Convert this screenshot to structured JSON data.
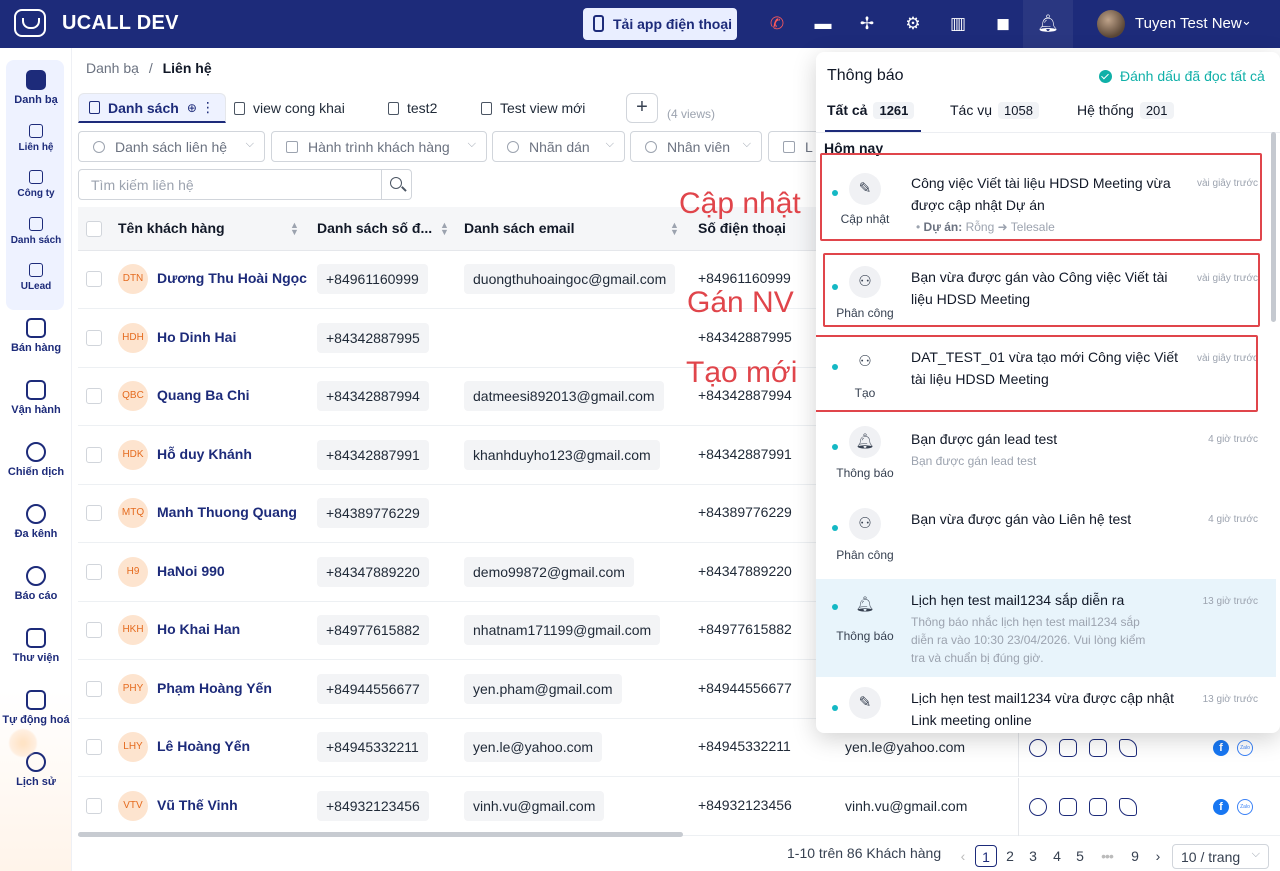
{
  "topbar": {
    "brand": "UCALL DEV",
    "app_button": "Tải app điện thoại",
    "user_name": "Tuyen Test New",
    "icons": [
      "phone-icon",
      "chat-icon",
      "apps-icon",
      "gear-icon",
      "book-icon",
      "briefcase-icon",
      "bell-icon"
    ]
  },
  "sidebar": {
    "items": [
      {
        "label": "Danh bạ",
        "icon": "contact-card-icon"
      },
      {
        "label": "Liên hệ",
        "icon": "users-icon"
      },
      {
        "label": "Công ty",
        "icon": "building-icon"
      },
      {
        "label": "Danh sách",
        "icon": "list-icon"
      },
      {
        "label": "ULead",
        "icon": "lead-icon"
      },
      {
        "label": "Bán hàng",
        "icon": "store-icon"
      },
      {
        "label": "Vận hành",
        "icon": "briefcase-icon"
      },
      {
        "label": "Chiến dịch",
        "icon": "target-icon"
      },
      {
        "label": "Đa kênh",
        "icon": "chat-bubble-icon"
      },
      {
        "label": "Báo cáo",
        "icon": "report-icon"
      },
      {
        "label": "Thư viện",
        "icon": "library-icon"
      },
      {
        "label": "Tự động hoá",
        "icon": "flow-icon"
      },
      {
        "label": "Lịch sử",
        "icon": "clock-icon"
      }
    ]
  },
  "breadcrumb": {
    "parent": "Danh bạ",
    "separator": "/",
    "current": "Liên hệ"
  },
  "views": {
    "tabs": [
      {
        "label": "Danh sách"
      },
      {
        "label": "view cong khai"
      },
      {
        "label": "test2"
      },
      {
        "label": "Test view mới"
      }
    ],
    "add": "+",
    "count": "(4 views)"
  },
  "filters": [
    "Danh sách liên hệ",
    "Hành trình khách hàng",
    "Nhãn dán",
    "Nhân viên",
    "L"
  ],
  "search": {
    "placeholder": "Tìm kiếm liên hệ"
  },
  "table": {
    "columns": [
      "Tên khách hàng",
      "Danh sách số đ...",
      "Danh sách email",
      "Số điện thoại"
    ],
    "rows": [
      {
        "initials": "DTN",
        "name": "Dương Thu Hoài Ngọc",
        "phone_list": "+84961160999",
        "email_list": "duongthuhoaingoc@gmail.com",
        "phone": "+84961160999",
        "email": ""
      },
      {
        "initials": "HDH",
        "name": "Ho Dinh Hai",
        "phone_list": "+84342887995",
        "email_list": "",
        "phone": "+84342887995",
        "email": ""
      },
      {
        "initials": "QBC",
        "name": "Quang Ba Chi",
        "phone_list": "+84342887994",
        "email_list": "datmeesi892013@gmail.com",
        "phone": "+84342887994",
        "email": ""
      },
      {
        "initials": "HDK",
        "name": "Hỗ duy Khánh",
        "phone_list": "+84342887991",
        "email_list": "khanhduyho123@gmail.com",
        "phone": "+84342887991",
        "email": ""
      },
      {
        "initials": "MTQ",
        "name": "Manh Thuong Quang",
        "phone_list": "+84389776229",
        "email_list": "",
        "phone": "+84389776229",
        "email": ""
      },
      {
        "initials": "H9",
        "name": "HaNoi 990",
        "phone_list": "+84347889220",
        "email_list": "demo99872@gmail.com",
        "phone": "+84347889220",
        "email": ""
      },
      {
        "initials": "HKH",
        "name": "Ho Khai Han",
        "phone_list": "+84977615882",
        "email_list": "nhatnam171199@gmail.com",
        "phone": "+84977615882",
        "email": ""
      },
      {
        "initials": "PHY",
        "name": "Phạm Hoàng Yến",
        "phone_list": "+84944556677",
        "email_list": "yen.pham@gmail.com",
        "phone": "+84944556677",
        "email": ""
      },
      {
        "initials": "LHY",
        "name": "Lê Hoàng Yến",
        "phone_list": "+84945332211",
        "email_list": "yen.le@yahoo.com",
        "phone": "+84945332211",
        "email": "yen.le@yahoo.com"
      },
      {
        "initials": "VTV",
        "name": "Vũ Thế Vinh",
        "phone_list": "+84932123456",
        "email_list": "vinh.vu@gmail.com",
        "phone": "+84932123456",
        "email": "vinh.vu@gmail.com"
      }
    ],
    "fb_glyph": "f",
    "zalo_text": "Zalo"
  },
  "pagination": {
    "summary": "1-10 trên 86 Khách hàng",
    "prev": "‹",
    "pages": [
      "1",
      "2",
      "3",
      "4",
      "5"
    ],
    "ellipsis": "•••",
    "last": "9",
    "next": "›",
    "page_size": "10 / trang",
    "current": 1
  },
  "notifications": {
    "title": "Thông báo",
    "mark_all_read": "Đánh dấu đã đọc tất cả",
    "tabs": [
      {
        "label": "Tất cả",
        "count": "1261"
      },
      {
        "label": "Tác vụ",
        "count": "1058"
      },
      {
        "label": "Hệ thống",
        "count": "201"
      }
    ],
    "section": "Hôm nay",
    "items": [
      {
        "icon": "pencil-icon",
        "caption": "Cập nhật",
        "text": "Công việc Viết tài liệu HDSD Meeting vừa được cập nhật Dự án",
        "sub_label": "Dự án:",
        "sub_value": "Rỗng ➜ Telesale",
        "time": "vài giây trước"
      },
      {
        "icon": "user-assign-icon",
        "caption": "Phân công",
        "text": "Bạn vừa được gán vào Công việc Viết tài liệu HDSD Meeting",
        "time": "vài giây trước"
      },
      {
        "icon": "user-add-icon",
        "caption": "Tạo",
        "text": "DAT_TEST_01 vừa tạo mới Công việc Viết tài liệu HDSD Meeting",
        "time": "vài giây trước"
      },
      {
        "icon": "bell-icon",
        "caption": "Thông báo",
        "text": "Bạn được gán lead test",
        "sub": "Bạn được gán lead test",
        "time": "4 giờ trước"
      },
      {
        "icon": "user-assign-icon",
        "caption": "Phân công",
        "text": "Bạn vừa được gán vào Liên hệ test",
        "time": "4 giờ trước"
      },
      {
        "icon": "bell-icon",
        "caption": "Thông báo",
        "text": "Lịch hẹn test mail1234 sắp diễn ra",
        "sub": "Thông báo nhắc lịch hẹn test mail1234 sắp diễn ra vào 10:30 23/04/2026. Vui lòng kiểm tra và chuẩn bị đúng giờ.",
        "time": "13 giờ trước"
      },
      {
        "icon": "pencil-icon",
        "caption": "",
        "text": "Lịch hẹn test mail1234 vừa được cập nhật Link meeting online",
        "time": "13 giờ trước"
      }
    ]
  },
  "annotations": {
    "update": "Cập nhật",
    "assign": "Gán NV",
    "create": "Tạo mới",
    "color": "#e0454b"
  },
  "colors": {
    "brand": "#1d2b7a",
    "accent": "#10b0a8",
    "dot": "#14b8c4"
  }
}
